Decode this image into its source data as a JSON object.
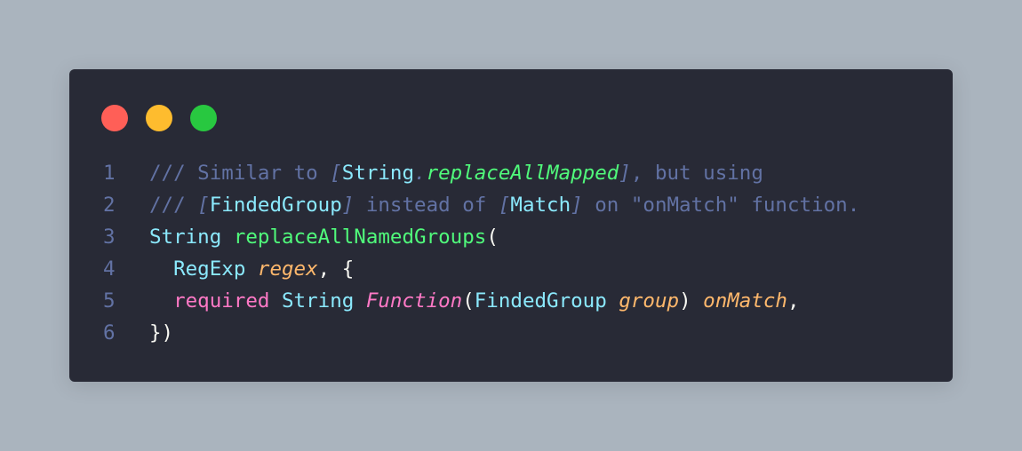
{
  "colors": {
    "background": "#aab4be",
    "window": "#282a36",
    "dot_close": "#ff5f57",
    "dot_minimize": "#febc2e",
    "dot_maximize": "#28c840"
  },
  "window_controls": {
    "close_icon": "red-circle",
    "minimize_icon": "yellow-circle",
    "maximize_icon": "green-circle"
  },
  "code": {
    "line_numbers": [
      "1",
      "2",
      "3",
      "4",
      "5",
      "6"
    ],
    "lines": [
      {
        "tokens": [
          {
            "text": "/// Similar to ",
            "type": "comment"
          },
          {
            "text": "[",
            "type": "punct-italic"
          },
          {
            "text": "String",
            "type": "type"
          },
          {
            "text": ".",
            "type": "punct-italic"
          },
          {
            "text": "replaceAllMapped",
            "type": "fn-italic"
          },
          {
            "text": "]",
            "type": "punct-italic"
          },
          {
            "text": ", but using",
            "type": "comment"
          }
        ]
      },
      {
        "tokens": [
          {
            "text": "/// ",
            "type": "comment"
          },
          {
            "text": "[",
            "type": "punct-italic"
          },
          {
            "text": "FindedGroup",
            "type": "type"
          },
          {
            "text": "]",
            "type": "punct-italic"
          },
          {
            "text": " instead of ",
            "type": "comment"
          },
          {
            "text": "[",
            "type": "punct-italic"
          },
          {
            "text": "Match",
            "type": "type"
          },
          {
            "text": "]",
            "type": "punct-italic"
          },
          {
            "text": " on \"onMatch\" function.",
            "type": "comment"
          }
        ]
      },
      {
        "tokens": [
          {
            "text": "String",
            "type": "type"
          },
          {
            "text": " ",
            "type": "plain"
          },
          {
            "text": "replaceAllNamedGroups",
            "type": "fn"
          },
          {
            "text": "(",
            "type": "plain"
          }
        ]
      },
      {
        "tokens": [
          {
            "text": "  ",
            "type": "plain"
          },
          {
            "text": "RegExp",
            "type": "type"
          },
          {
            "text": " ",
            "type": "plain"
          },
          {
            "text": "regex",
            "type": "param"
          },
          {
            "text": ", {",
            "type": "plain"
          }
        ]
      },
      {
        "tokens": [
          {
            "text": "  ",
            "type": "plain"
          },
          {
            "text": "required",
            "type": "kw"
          },
          {
            "text": " ",
            "type": "plain"
          },
          {
            "text": "String",
            "type": "type"
          },
          {
            "text": " ",
            "type": "plain"
          },
          {
            "text": "Function",
            "type": "kw-italic"
          },
          {
            "text": "(",
            "type": "plain"
          },
          {
            "text": "FindedGroup",
            "type": "type"
          },
          {
            "text": " ",
            "type": "plain"
          },
          {
            "text": "group",
            "type": "param"
          },
          {
            "text": ") ",
            "type": "plain"
          },
          {
            "text": "onMatch",
            "type": "param"
          },
          {
            "text": ",",
            "type": "plain"
          }
        ]
      },
      {
        "tokens": [
          {
            "text": "})",
            "type": "plain"
          }
        ]
      }
    ]
  }
}
